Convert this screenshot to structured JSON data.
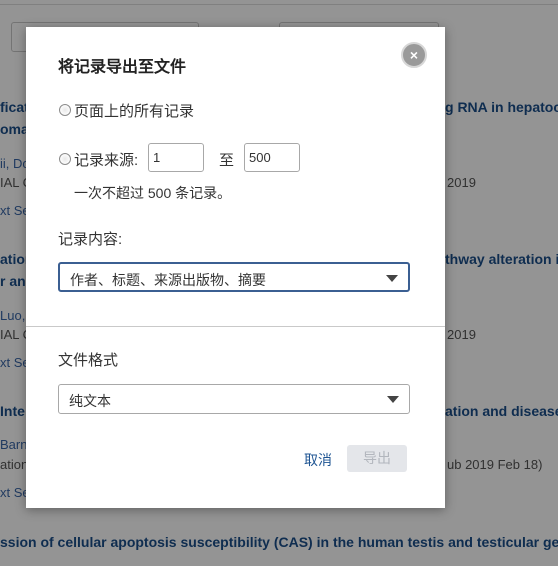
{
  "background": {
    "items": [
      {
        "title_left": "ficat",
        "title_right": "g RNA in hepatoc",
        "title_left2": "oma",
        "author": "ii, Do",
        "meta_left": "IAL C",
        "meta_right": "2019",
        "link": "xt Se"
      },
      {
        "title_left": "ation",
        "title_right": "thway alteration i",
        "title_left2": "r and",
        "author": "Luo, X",
        "meta_left": "IAL C",
        "meta_right": "2019",
        "link": "xt Se"
      },
      {
        "title_left": "Inte",
        "title_right": "ation and disease",
        "author": "Barna",
        "meta_left": "ation",
        "meta_right": "ub 2019 Feb 18)",
        "link": "xt Se"
      }
    ],
    "bottom_title": "ssion of cellular apoptosis susceptibility (CAS) in the human testis and testicular germ"
  },
  "dialog": {
    "title": "将记录导出至文件",
    "close_icon": "×",
    "option_all": "页面上的所有记录",
    "option_range": "记录来源:",
    "range_from": "1",
    "range_to_label": "至",
    "range_to": "500",
    "range_note": "一次不超过 500 条记录。",
    "content_label": "记录内容:",
    "content_selected": "作者、标题、来源出版物、摘要",
    "format_label": "文件格式",
    "format_selected": "纯文本",
    "cancel": "取消",
    "export": "导出"
  },
  "colors": {
    "accent": "#1f5593",
    "select_focus_border": "#3b5f92",
    "export_disabled_bg": "#e4e6ea"
  }
}
